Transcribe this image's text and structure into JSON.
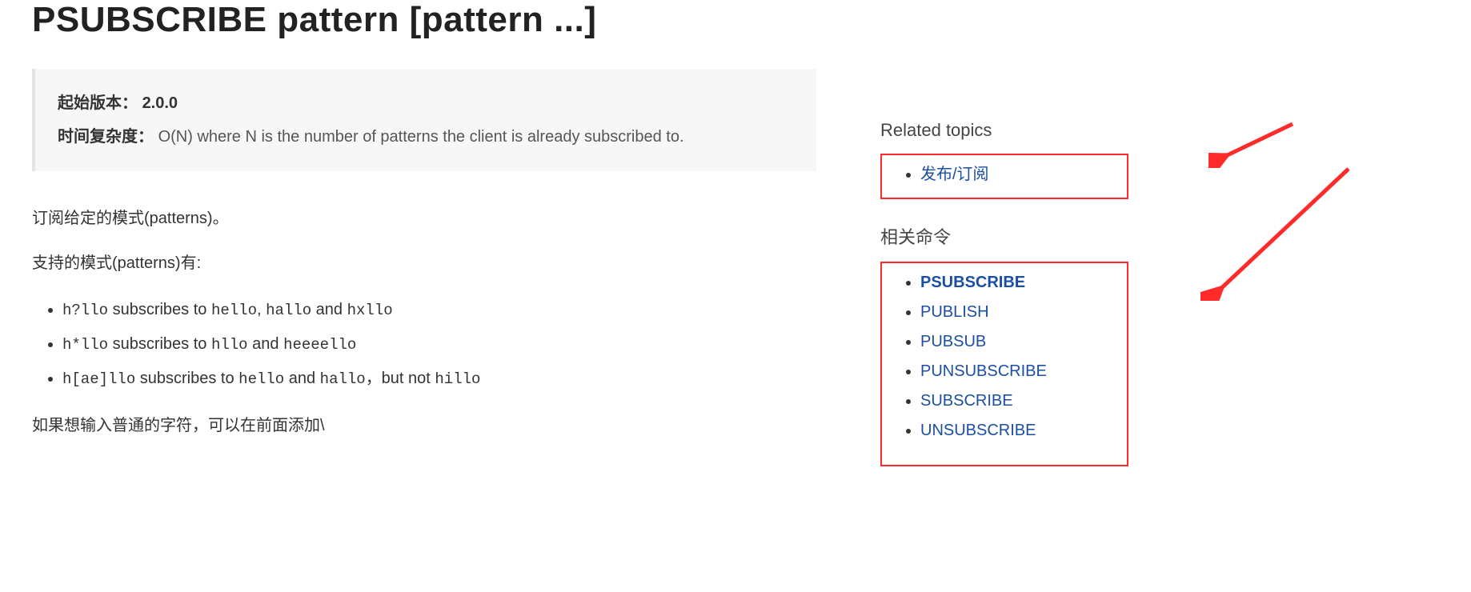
{
  "title": "PSUBSCRIBE pattern [pattern ...]",
  "since_box": {
    "since_label": "起始版本：",
    "since_value": "2.0.0",
    "complexity_label": "时间复杂度：",
    "complexity_value": "O(N) where N is the number of patterns the client is already subscribed to."
  },
  "body": {
    "p1": "订阅给定的模式(patterns)。",
    "p2": "支持的模式(patterns)有:",
    "examples": [
      {
        "pattern": "h?llo",
        "mid": " subscribes to ",
        "matches": [
          "hello",
          "hallo",
          "hxllo"
        ],
        "but_not": null
      },
      {
        "pattern": "h*llo",
        "mid": " subscribes to ",
        "matches": [
          "hllo",
          "heeeello"
        ],
        "but_not": null
      },
      {
        "pattern": "h[ae]llo",
        "mid": " subscribes to ",
        "matches": [
          "hello",
          "hallo"
        ],
        "but_not": "hillo"
      }
    ],
    "and_word": " and ",
    "comma": ", ",
    "but_not_label": "，but not ",
    "p3": "如果想输入普通的字符，可以在前面添加\\"
  },
  "sidebar": {
    "related_title": "Related topics",
    "related_items": [
      {
        "label": "发布/订阅"
      }
    ],
    "commands_title": "相关命令",
    "commands": [
      {
        "label": "PSUBSCRIBE",
        "current": true
      },
      {
        "label": "PUBLISH",
        "current": false
      },
      {
        "label": "PUBSUB",
        "current": false
      },
      {
        "label": "PUNSUBSCRIBE",
        "current": false
      },
      {
        "label": "SUBSCRIBE",
        "current": false
      },
      {
        "label": "UNSUBSCRIBE",
        "current": false
      }
    ]
  },
  "colors": {
    "link": "#1b4ea5",
    "highlight_box": "#ff2a2a",
    "arrow": "#ff2a2a"
  }
}
